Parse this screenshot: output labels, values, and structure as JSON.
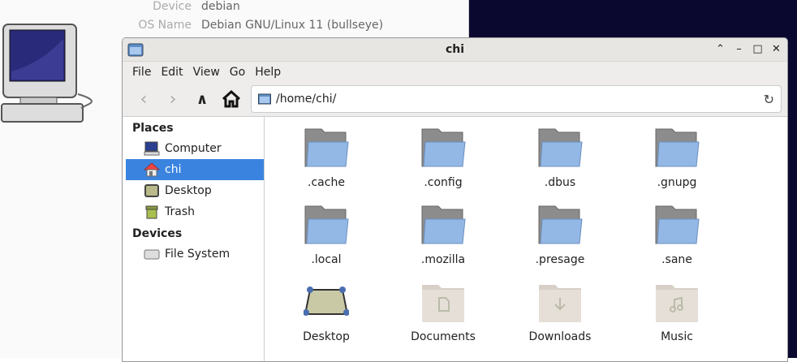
{
  "about": {
    "rows": [
      {
        "label": "Device",
        "value": "debian"
      },
      {
        "label": "OS Name",
        "value": "Debian GNU/Linux 11 (bullseye)"
      }
    ]
  },
  "window": {
    "title": "chi"
  },
  "menu": [
    "File",
    "Edit",
    "View",
    "Go",
    "Help"
  ],
  "address": "/home/chi/",
  "sidebar": {
    "places_header": "Places",
    "places": [
      "Computer",
      "chi",
      "Desktop",
      "Trash"
    ],
    "devices_header": "Devices",
    "devices": [
      "File System"
    ],
    "selected": "chi"
  },
  "files": [
    ".cache",
    ".config",
    ".dbus",
    ".gnupg",
    ".local",
    ".mozilla",
    ".presage",
    ".sane",
    "Desktop",
    "Documents",
    "Downloads",
    "Music"
  ],
  "colors": {
    "selection": "#3a84e0",
    "folder": "#8fb4e3",
    "background": "#0b0830"
  }
}
